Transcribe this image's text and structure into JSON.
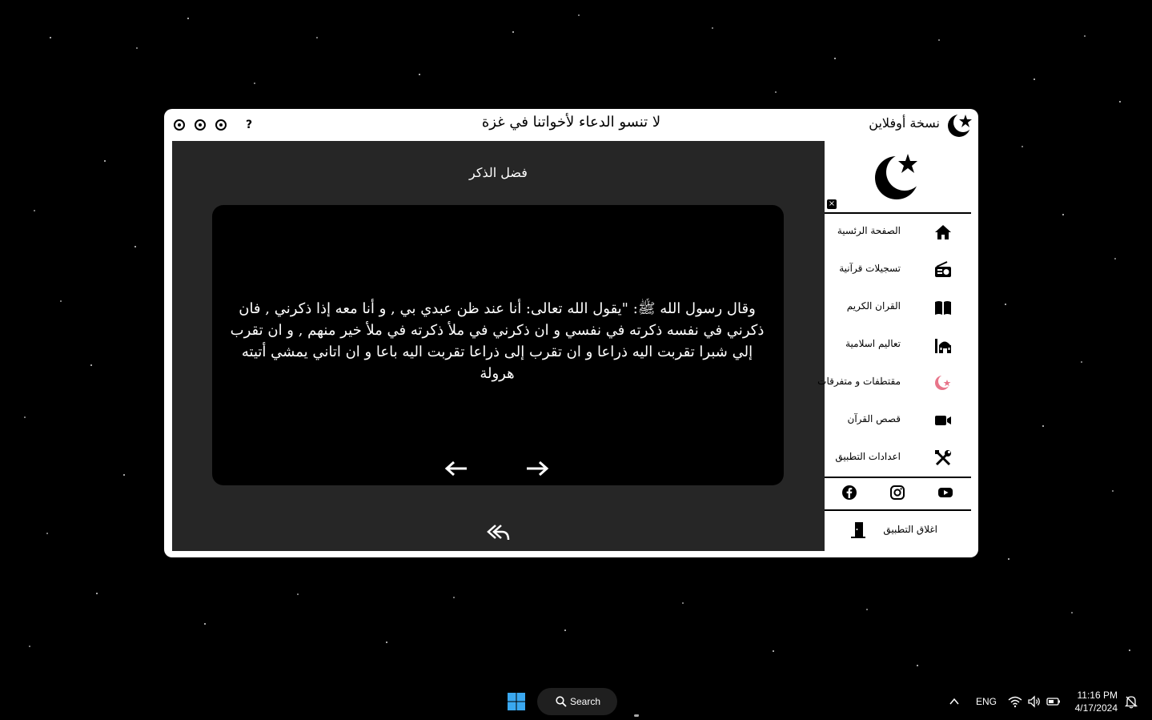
{
  "window": {
    "app_name": "نسخة أوفلاين",
    "banner": "لا تنسو الدعاء لأخواتنا في غزة",
    "help_label": "?"
  },
  "main": {
    "title": "فضل الذكر",
    "hadith": "وقال رسول الله ﷺ: \"يقول الله تعالى: أنا عند ظن عبدي بي , و أنا معه إذا ذكرني , فان ذكرني في نفسه ذكرته في نفسي و ان ذكرني في ملأ ذكرته في ملأ خير منهم , و ان تقرب إلي شبرا تقربت اليه ذراعا و ان تقرب إلى ذراعا تقربت اليه باعا و ان اتاني يمشي أتيته هرولة"
  },
  "sidebar": {
    "close_label": "×",
    "items": [
      {
        "label": "الصفحة الرئسية",
        "icon": "home-icon"
      },
      {
        "label": "تسجيلات قرآنية",
        "icon": "radio-icon"
      },
      {
        "label": "القران الكريم",
        "icon": "book-icon"
      },
      {
        "label": "تعاليم اسلامية",
        "icon": "mosque-icon"
      },
      {
        "label": "مقتطفات و متفرقات",
        "icon": "crescent-star-icon"
      },
      {
        "label": "قصص القرآن",
        "icon": "video-camera-icon"
      },
      {
        "label": "اعدادات التطبيق",
        "icon": "tools-icon"
      }
    ],
    "social": [
      "facebook-icon",
      "instagram-icon",
      "youtube-icon"
    ],
    "exit_label": "اغلاق التطبيق"
  },
  "taskbar": {
    "search_label": "Search",
    "language": "ENG",
    "time": "11:16 PM",
    "date": "4/17/2024"
  },
  "colors": {
    "main_panel": "#262626",
    "card": "#000000",
    "sidebar": "#ffffff",
    "crescent_pink": "#e8758a"
  }
}
